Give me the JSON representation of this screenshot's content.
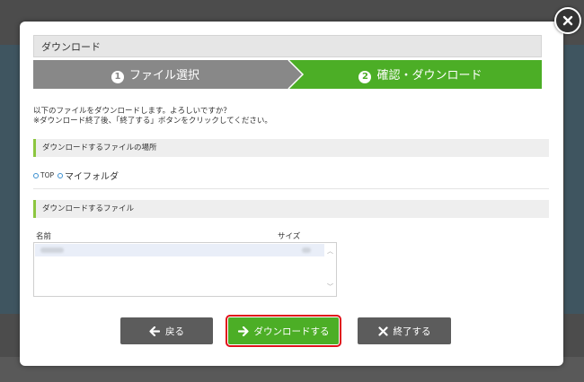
{
  "dialog": {
    "title": "ダウンロード"
  },
  "steps": [
    {
      "number": "1",
      "label": "ファイル選択",
      "state": "done"
    },
    {
      "number": "2",
      "label": "確認・ダウンロード",
      "state": "active"
    }
  ],
  "message": {
    "line1": "以下のファイルをダウンロードします。よろしいですか？",
    "line2": "※ダウンロード終了後、「終了する」ボタンをクリックしてください。"
  },
  "location_section": {
    "header": "ダウンロードするファイルの場所",
    "breadcrumb": [
      "TOP",
      "マイフォルダ"
    ]
  },
  "file_section": {
    "header": "ダウンロードするファイル",
    "columns": {
      "name": "名前",
      "size": "サイズ"
    }
  },
  "buttons": {
    "back": "戻る",
    "download": "ダウンロードする",
    "finish": "終了する"
  },
  "colors": {
    "accent_green": "#4cae26",
    "step_inactive": "#888888",
    "button_gray": "#5c5c5c",
    "highlight_red": "#e0101a"
  },
  "icons": {
    "close": "close-icon",
    "back": "arrow-left-icon",
    "download": "arrow-right-icon",
    "finish": "x-icon"
  }
}
